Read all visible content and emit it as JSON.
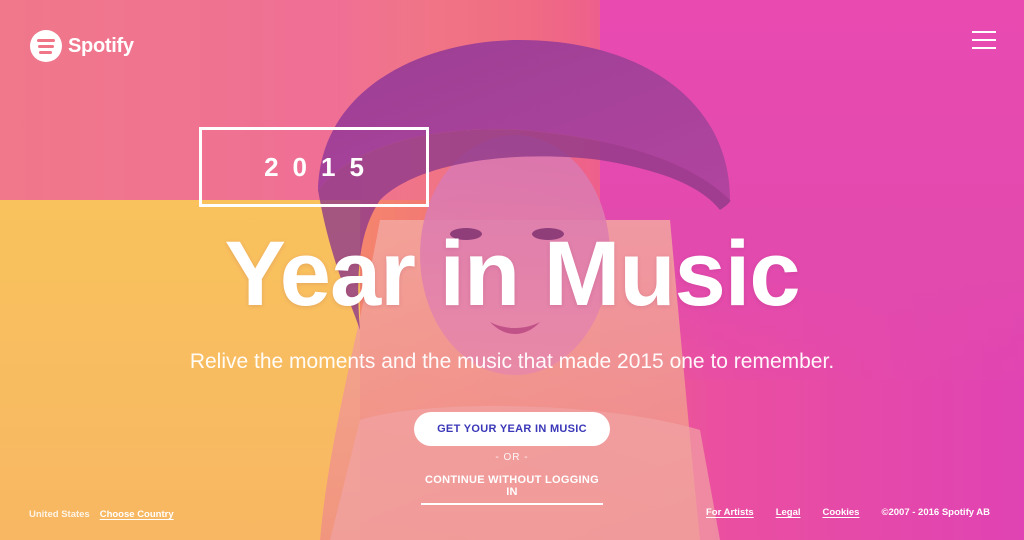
{
  "brand": {
    "name": "Spotify",
    "icon": "spotify-logo-icon"
  },
  "header": {
    "menu_icon": "hamburger-menu-icon"
  },
  "hero": {
    "year": "2015",
    "title": "Year in Music",
    "subtitle": "Relive the moments and the music that made 2015 one to remember.",
    "cta_label": "GET YOUR YEAR IN MUSIC",
    "divider": "- OR -",
    "secondary_label": "CONTINUE WITHOUT LOGGING IN"
  },
  "footer": {
    "country": "United States",
    "choose_country": "Choose Country",
    "links": [
      "For Artists",
      "Legal",
      "Cookies"
    ],
    "copyright": "©2007 - 2016 Spotify AB"
  },
  "colors": {
    "accent": "#3a37b8",
    "pink": "#e043b3",
    "orange": "#f7c45f",
    "coral": "#f0788a"
  }
}
